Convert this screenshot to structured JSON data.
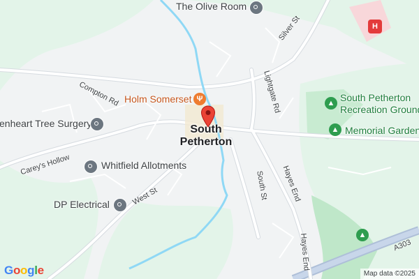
{
  "map": {
    "town": {
      "line1": "South",
      "line2": "Petherton"
    },
    "places": [
      {
        "name": "The Olive Room",
        "icon": "place-icon"
      },
      {
        "name": "Holm Somerset",
        "icon": "restaurant-icon"
      },
      {
        "name": "enheart Tree Surgery",
        "icon": "place-icon"
      },
      {
        "name": "Whitfield Allotments",
        "icon": "place-icon"
      },
      {
        "name": "DP Electrical",
        "icon": "place-icon"
      },
      {
        "name": "South Petherton Recreation Ground",
        "line1": "South Petherton",
        "line2": "Recreation Ground",
        "icon": "park-icon"
      },
      {
        "name": "Memorial Garden",
        "icon": "park-icon"
      }
    ],
    "roads": {
      "silver_st": "Silver St",
      "compton_rd": "Compton Rd",
      "lightgate_rd": "Lightgate Rd",
      "careys_hollow": "Carey's Hollow",
      "west_st": "West St",
      "south_st": "South St",
      "hayes_end_1": "Hayes End",
      "hayes_end_2": "Hayes End",
      "a303": "A303"
    },
    "hospital_icon": "hospital-icon",
    "marker_icon": "location-pin-icon",
    "colors": {
      "land": "#f1f3f4",
      "green": "#e3f4e9",
      "park": "#bfe7c9",
      "water": "#8fd8f5",
      "road": "#ffffff",
      "road_outline": "#d6dbe0",
      "motorway": "#aebfd8",
      "marker": "#ea4335"
    }
  },
  "branding": {
    "logo": "Google",
    "attribution": "Map data ©2025"
  }
}
